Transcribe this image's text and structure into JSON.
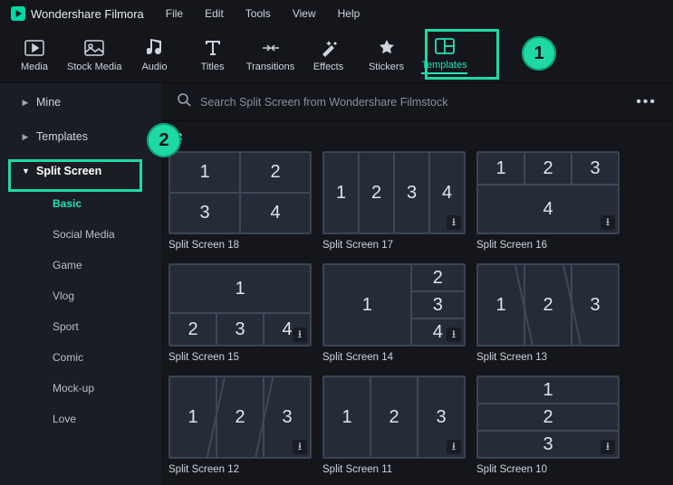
{
  "app": {
    "name": "Wondershare Filmora"
  },
  "menu": {
    "file": "File",
    "edit": "Edit",
    "tools": "Tools",
    "view": "View",
    "help": "Help"
  },
  "toolbar": {
    "media": "Media",
    "stock_media": "Stock Media",
    "audio": "Audio",
    "titles": "Titles",
    "transitions": "Transitions",
    "effects": "Effects",
    "stickers": "Stickers",
    "templates": "Templates"
  },
  "search": {
    "placeholder": "Search Split Screen from Wondershare Filmstock"
  },
  "sidebar": {
    "mine": "Mine",
    "templates": "Templates",
    "split_screen": "Split Screen",
    "subs": {
      "basic": "Basic",
      "social_media": "Social Media",
      "game": "Game",
      "vlog": "Vlog",
      "sport": "Sport",
      "comic": "Comic",
      "mockup": "Mock-up",
      "love": "Love"
    }
  },
  "section": {
    "title_suffix": "C"
  },
  "cards": {
    "c18": "Split Screen 18",
    "c17": "Split Screen 17",
    "c16": "Split Screen 16",
    "c15": "Split Screen 15",
    "c14": "Split Screen 14",
    "c13": "Split Screen 13",
    "c12": "Split Screen 12",
    "c11": "Split Screen 11",
    "c10": "Split Screen 10"
  },
  "annotations": {
    "one": "1",
    "two": "2"
  }
}
